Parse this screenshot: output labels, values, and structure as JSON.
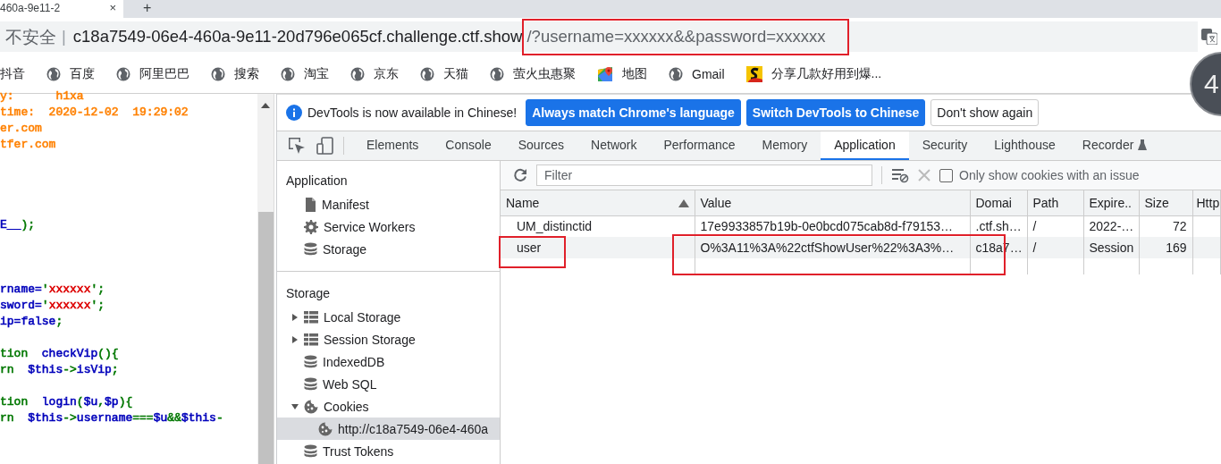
{
  "browser": {
    "tab": {
      "title": "460a-9e11-2",
      "close": "×",
      "new_tab": "+"
    },
    "address": {
      "security": "不安全",
      "separator": "|",
      "host": "c18a7549-06e4-460a-9e11-20d796e065cf.challenge.ctf.show",
      "path": "/?username=xxxxxx&&password=xxxxxx"
    },
    "bookmarks": [
      {
        "label": "抖音",
        "kind": "none"
      },
      {
        "label": "百度",
        "kind": "globe"
      },
      {
        "label": "阿里巴巴",
        "kind": "globe"
      },
      {
        "label": "搜索",
        "kind": "globe"
      },
      {
        "label": "淘宝",
        "kind": "globe"
      },
      {
        "label": "京东",
        "kind": "globe"
      },
      {
        "label": "天猫",
        "kind": "globe"
      },
      {
        "label": "萤火虫惠聚",
        "kind": "globe"
      },
      {
        "label": "地图",
        "kind": "map"
      },
      {
        "label": "Gmail",
        "kind": "globe"
      },
      {
        "label": "分享几款好用到爆...",
        "kind": "logo"
      }
    ],
    "badge": "4"
  },
  "code_blocks": [
    {
      "kind": "first",
      "lines": [
        {
          "segments": [
            {
              "text": "y:      h1xa",
              "color": "#ff8000"
            }
          ]
        },
        {
          "segments": [
            {
              "text": "time:  2020-12-02  19:29:02",
              "color": "#ff8000"
            }
          ]
        },
        {
          "segments": [
            {
              "text": "er.com",
              "color": "#ff8000"
            }
          ]
        },
        {
          "segments": [
            {
              "text": "tfer.com",
              "color": "#ff8000"
            }
          ]
        }
      ]
    },
    {
      "kind": "wide",
      "lines": [
        {
          "segments": [
            {
              "text": "E__",
              "color": "#0000bb"
            },
            {
              "text": ");",
              "color": "#007700"
            }
          ]
        }
      ]
    },
    {
      "kind": "mid",
      "lines": [
        {
          "segments": [
            {
              "text": "rname=",
              "color": "#0000bb"
            },
            {
              "text": "'",
              "color": "#007700"
            },
            {
              "text": "xxxxxx",
              "color": "#dd0000"
            },
            {
              "text": "';",
              "color": "#007700"
            }
          ]
        },
        {
          "segments": [
            {
              "text": "sword=",
              "color": "#0000bb"
            },
            {
              "text": "'",
              "color": "#007700"
            },
            {
              "text": "xxxxxx",
              "color": "#dd0000"
            },
            {
              "text": "';",
              "color": "#007700"
            }
          ]
        },
        {
          "segments": [
            {
              "text": "ip=false",
              "color": "#0000bb"
            },
            {
              "text": ";",
              "color": "#007700"
            }
          ]
        }
      ]
    },
    {
      "kind": "near",
      "lines": [
        {
          "segments": [
            {
              "text": "tion  ",
              "color": "#007700"
            },
            {
              "text": "checkVip",
              "color": "#0000bb"
            },
            {
              "text": "(){",
              "color": "#007700"
            }
          ]
        },
        {
          "segments": [
            {
              "text": "rn  ",
              "color": "#007700"
            },
            {
              "text": "$this",
              "color": "#0000bb"
            },
            {
              "text": "->",
              "color": "#007700"
            },
            {
              "text": "isVip",
              "color": "#0000bb"
            },
            {
              "text": ";",
              "color": "#007700"
            }
          ]
        }
      ]
    },
    {
      "kind": "near",
      "lines": [
        {
          "segments": [
            {
              "text": "tion  ",
              "color": "#007700"
            },
            {
              "text": "login",
              "color": "#0000bb"
            },
            {
              "text": "(",
              "color": "#007700"
            },
            {
              "text": "$u",
              "color": "#0000bb"
            },
            {
              "text": ",",
              "color": "#007700"
            },
            {
              "text": "$p",
              "color": "#0000bb"
            },
            {
              "text": "){",
              "color": "#007700"
            }
          ]
        },
        {
          "segments": [
            {
              "text": "rn  ",
              "color": "#007700"
            },
            {
              "text": "$this",
              "color": "#0000bb"
            },
            {
              "text": "->",
              "color": "#007700"
            },
            {
              "text": "username",
              "color": "#0000bb"
            },
            {
              "text": "===",
              "color": "#007700"
            },
            {
              "text": "$u",
              "color": "#0000bb"
            },
            {
              "text": "&&",
              "color": "#007700"
            },
            {
              "text": "$this",
              "color": "#0000bb"
            },
            {
              "text": "-",
              "color": "#007700"
            }
          ]
        }
      ]
    }
  ],
  "devtools": {
    "infobar": {
      "message": "DevTools is now available in Chinese!",
      "buttons": [
        {
          "label": "Always match Chrome's language",
          "kind": "primary"
        },
        {
          "label": "Switch DevTools to Chinese",
          "kind": "primary"
        },
        {
          "label": "Don't show again",
          "kind": "plain"
        }
      ]
    },
    "tabs": [
      {
        "label": "Elements",
        "selected": false
      },
      {
        "label": "Console",
        "selected": false
      },
      {
        "label": "Sources",
        "selected": false
      },
      {
        "label": "Network",
        "selected": false
      },
      {
        "label": "Performance",
        "selected": false
      },
      {
        "label": "Memory",
        "selected": false
      },
      {
        "label": "Application",
        "selected": true
      },
      {
        "label": "Security",
        "selected": false
      },
      {
        "label": "Lighthouse",
        "selected": false
      },
      {
        "label": "Recorder",
        "selected": false
      }
    ],
    "sidebar": [
      {
        "title": "Application",
        "items": [
          {
            "label": "Manifest",
            "kind": "file",
            "selected": false
          },
          {
            "label": "Service Workers",
            "kind": "gear",
            "selected": false
          },
          {
            "label": "Storage",
            "kind": "db",
            "selected": false
          }
        ]
      },
      {
        "title": "Storage",
        "items": [
          {
            "label": "Local Storage",
            "kind": "grid",
            "expanded": false,
            "selected": false
          },
          {
            "label": "Session Storage",
            "kind": "grid",
            "expanded": false,
            "selected": false
          },
          {
            "label": "IndexedDB",
            "kind": "db",
            "selected": false
          },
          {
            "label": "Web SQL",
            "kind": "db",
            "selected": false
          },
          {
            "label": "Cookies",
            "kind": "cookie",
            "expanded": true,
            "selected": false,
            "children": [
              {
                "label": "http://c18a7549-06e4-460a",
                "kind": "cookie",
                "selected": true
              }
            ]
          },
          {
            "label": "Trust Tokens",
            "kind": "db",
            "selected": false
          }
        ]
      }
    ],
    "cookies": {
      "filter_placeholder": "Filter",
      "issue_only": {
        "label": "Only show cookies with an issue",
        "checked": false
      },
      "columns": [
        {
          "label": "Name",
          "sorted": true
        },
        {
          "label": "Value",
          "sorted": false
        },
        {
          "label": "Domai",
          "sorted": false
        },
        {
          "label": "Path",
          "sorted": false
        },
        {
          "label": "Expire..",
          "sorted": false
        },
        {
          "label": "Size",
          "sorted": false
        },
        {
          "label": "Http",
          "sorted": false
        }
      ],
      "rows": [
        {
          "cells": [
            "UM_distinctid",
            "17e9933857b19b-0e0bcd075cab8d-f79153…",
            ".ctf.sh…",
            "/",
            "2022-…",
            "72",
            ""
          ],
          "selected": false
        },
        {
          "cells": [
            "user",
            "O%3A11%3A%22ctfShowUser%22%3A3%…",
            "c18a7…",
            "/",
            "Session",
            "169",
            ""
          ],
          "selected": true
        }
      ]
    }
  }
}
